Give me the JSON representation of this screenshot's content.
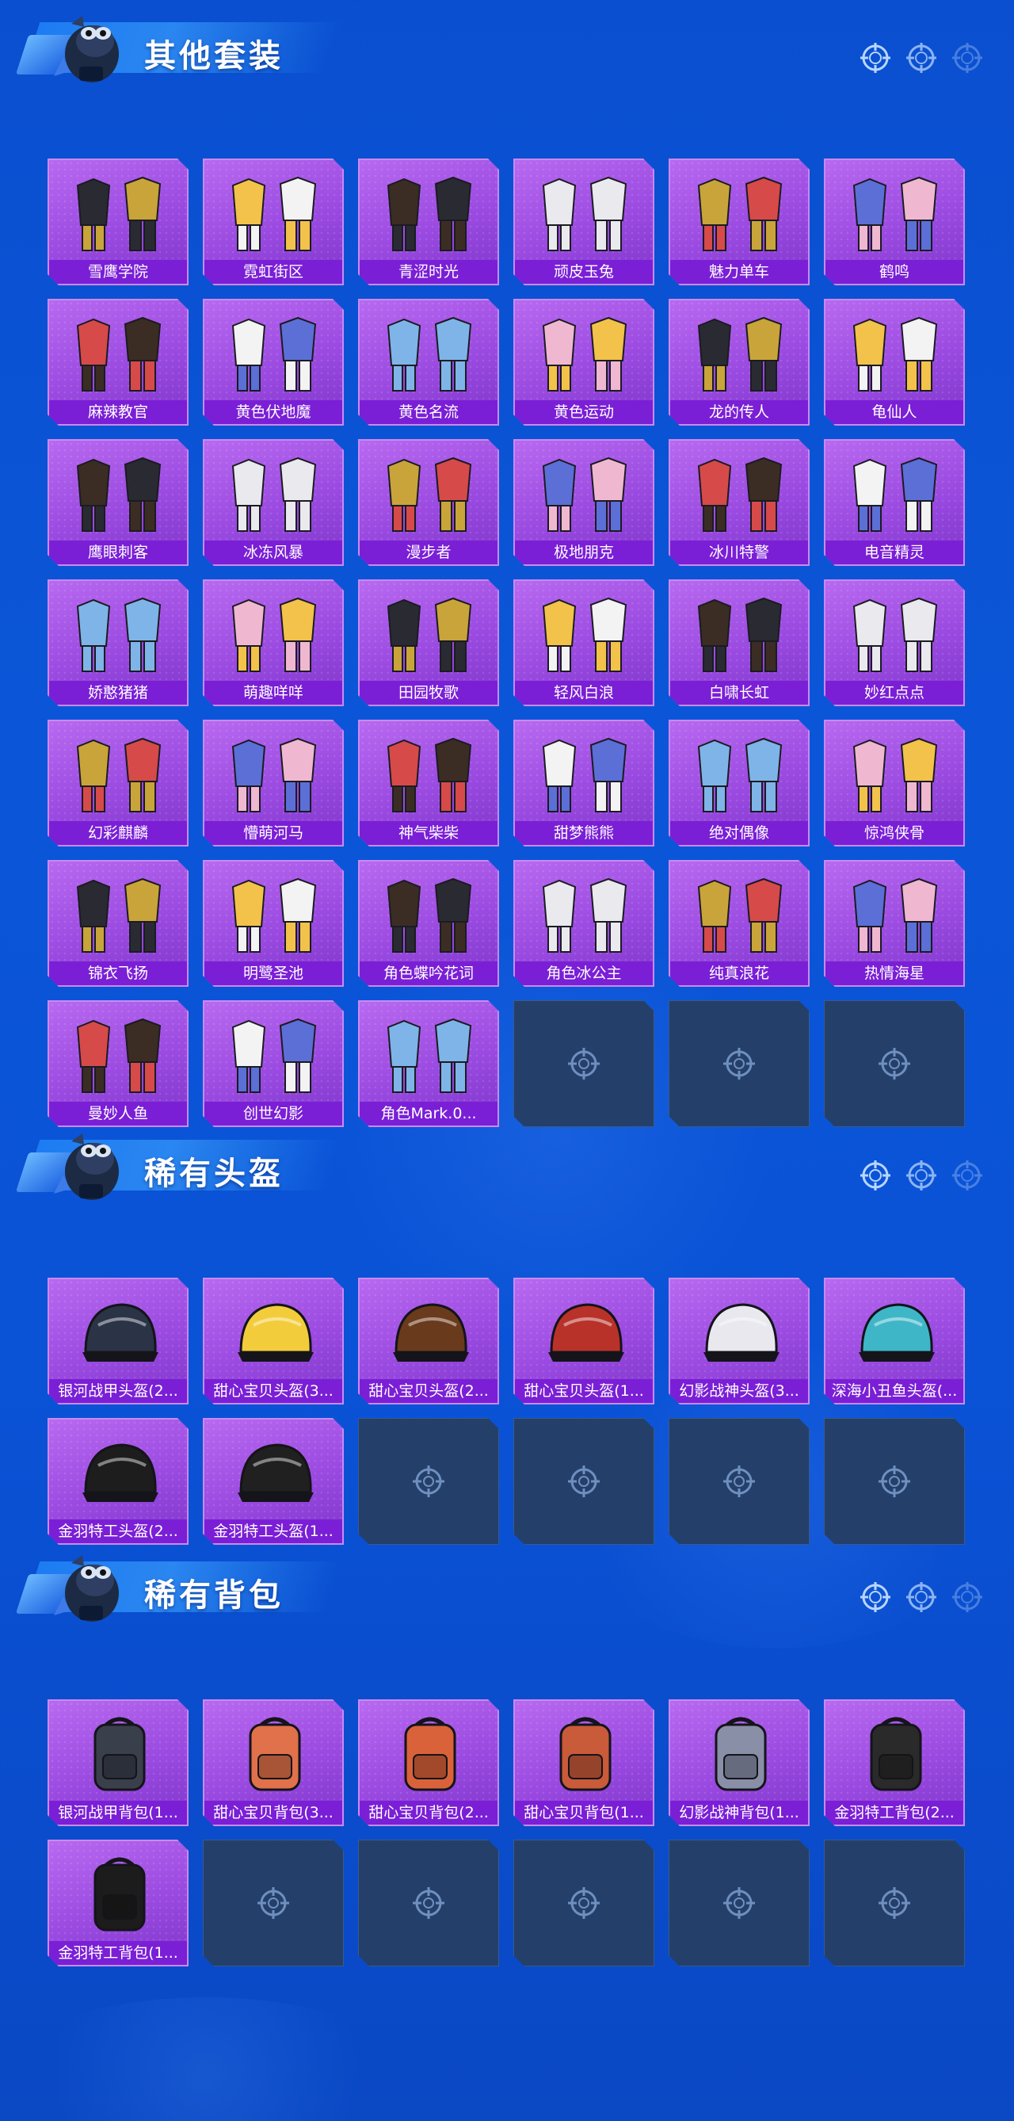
{
  "colors": {
    "background": "#0a52d6",
    "tile_fill": "#a456e6",
    "tile_label_bg": "#7a1fd6",
    "empty_tile": "#24406a"
  },
  "sections": [
    {
      "title": "其他套装",
      "items": [
        "雪鹰学院",
        "霓虹街区",
        "青涩时光",
        "顽皮玉兔",
        "魅力单车",
        "鹤鸣",
        "麻辣教官",
        "黄色伏地魔",
        "黄色名流",
        "黄色运动",
        "龙的传人",
        "龟仙人",
        "鹰眼刺客",
        "冰冻风暴",
        "漫步者",
        "极地朋克",
        "冰川特警",
        "电音精灵",
        "娇憨猪猪",
        "萌趣咩咩",
        "田园牧歌",
        "轻风白浪",
        "白啸长虹",
        "妙红点点",
        "幻彩麒麟",
        "懵萌河马",
        "神气柴柴",
        "甜梦熊熊",
        "绝对偶像",
        "惊鸿侠骨",
        "锦衣飞扬",
        "明鹭圣池",
        "角色蝶吟花词",
        "角色冰公主",
        "纯真浪花",
        "热情海星",
        "曼妙人鱼",
        "创世幻影",
        "角色Mark.0..."
      ],
      "empty_slots": 3
    },
    {
      "title": "稀有头盔",
      "items": [
        "银河战甲头盔(2...",
        "甜心宝贝头盔(3...",
        "甜心宝贝头盔(2...",
        "甜心宝贝头盔(1...",
        "幻影战神头盔(3...",
        "深海小丑鱼头盔(...",
        "金羽特工头盔(2...",
        "金羽特工头盔(1..."
      ],
      "empty_slots": 4
    },
    {
      "title": "稀有背包",
      "items": [
        "银河战甲背包(1...",
        "甜心宝贝背包(3...",
        "甜心宝贝背包(2...",
        "甜心宝贝背包(1...",
        "幻影战神背包(1...",
        "金羽特工背包(2...",
        "金羽特工背包(1..."
      ],
      "empty_slots": 5
    }
  ]
}
